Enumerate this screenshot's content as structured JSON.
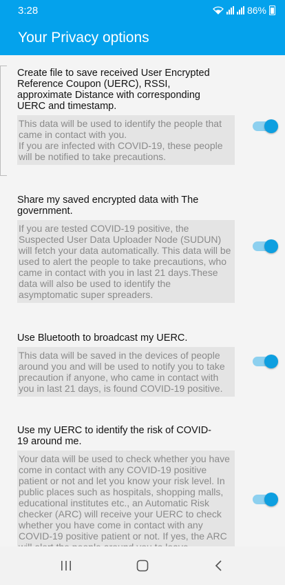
{
  "status_bar": {
    "time": "3:28",
    "battery": "86%"
  },
  "app_bar": {
    "title": "Your Privacy options"
  },
  "options": [
    {
      "title": "Create file to save received User Encrypted Reference Coupon (UERC), RSSI, approximate Distance with corresponding UERC and timestamp.",
      "description": "This data will be used to identify the people that came in contact with you.\nIf you are infected with COVID-19, these people will be notified to take precautions.",
      "enabled": true
    },
    {
      "title": "Share my saved encrypted data with The government.",
      "description": "If you are tested COVID-19 positive, the Suspected User Data Uploader Node (SUDUN) will fetch your data automatically. This data will be used to alert the people to take precautions, who came in contact with you in last 21 days.These data will also be used to identify the asymptomatic super spreaders.",
      "enabled": true
    },
    {
      "title": "Use Bluetooth to broadcast my UERC.",
      "description": "This data will be saved in the devices of people around you and will be used to notify you to take precaution if anyone, who came in contact with you in last 21 days, is found COVID-19 positive.",
      "enabled": true
    },
    {
      "title": "Use my UERC to identify the risk of COVID-19 around me.",
      "description": "Your data will be used to check whether you have come in contact with any COVID-19 positive patient or not and let you know your risk level. In public places such as hospitals, shopping malls, educational institutes etc., an Automatic Risk checker (ARC) will receive your UERC to check whether you have come in contact with any COVID-19 positive patient or not. If yes, the ARC will alert the people around you to leave",
      "enabled": true
    }
  ],
  "colors": {
    "primary": "#04a2ec",
    "toggle_track": "#8dd0ef",
    "toggle_knob": "#0e9fe0"
  }
}
